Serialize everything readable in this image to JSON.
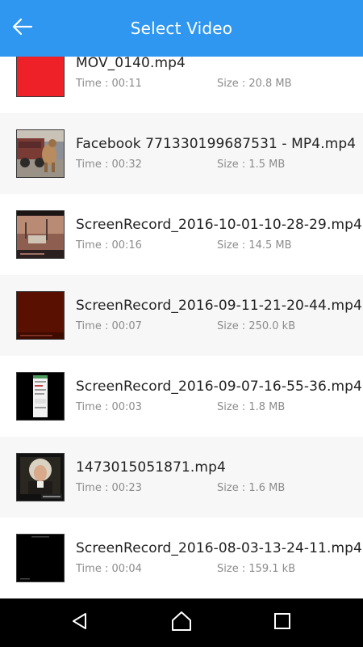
{
  "appbar": {
    "title": "Select Video",
    "back_icon": "arrow-left-icon"
  },
  "videos": [
    {
      "name": "MOV_0140.mp4",
      "time": "Time : 00:11",
      "size": "Size : 20.8 MB",
      "thumb": "red-frame"
    },
    {
      "name": "Facebook 771330199687531 - MP4.mp4",
      "time": "Time : 00:32",
      "size": "Size : 1.5 MB",
      "thumb": "car-and-dog-photo"
    },
    {
      "name": "ScreenRecord_2016-10-01-10-28-29.mp4",
      "time": "Time : 00:16",
      "size": "Size : 14.5 MB",
      "thumb": "video-player-screenshot"
    },
    {
      "name": "ScreenRecord_2016-09-11-21-20-44.mp4",
      "time": "Time : 00:07",
      "size": "Size : 250.0 kB",
      "thumb": "dark-red-frame"
    },
    {
      "name": "ScreenRecord_2016-09-07-16-55-36.mp4",
      "time": "Time : 00:03",
      "size": "Size : 1.8 MB",
      "thumb": "phone-app-screenshot"
    },
    {
      "name": "1473015051871.mp4",
      "time": "Time : 00:23",
      "size": "Size : 1.6 MB",
      "thumb": "portrait-painting"
    },
    {
      "name": "ScreenRecord_2016-08-03-13-24-11.mp4",
      "time": "Time : 00:04",
      "size": "Size : 159.1 kB",
      "thumb": "black-frame"
    }
  ],
  "navbar": {
    "back": "triangle-back-icon",
    "home": "home-icon",
    "recents": "square-recents-icon"
  },
  "colors": {
    "appbar": "#2f97ef",
    "row_alt": "#f7f7f7",
    "text_primary": "#222222",
    "text_secondary": "#8c8c8c"
  }
}
